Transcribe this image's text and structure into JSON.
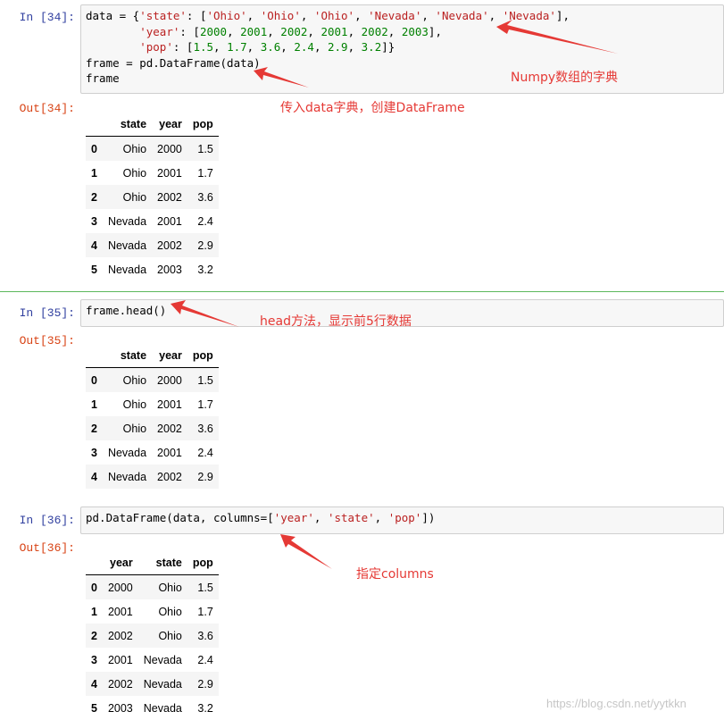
{
  "cells": [
    {
      "in_prompt": "In  [34]:",
      "out_prompt": "Out[34]:",
      "code_lines": [
        [
          [
            "k",
            "data = {"
          ],
          [
            "s",
            "'state'"
          ],
          [
            "k",
            ": ["
          ],
          [
            "s",
            "'Ohio'"
          ],
          [
            "k",
            ", "
          ],
          [
            "s",
            "'Ohio'"
          ],
          [
            "k",
            ", "
          ],
          [
            "s",
            "'Ohio'"
          ],
          [
            "k",
            ", "
          ],
          [
            "s",
            "'Nevada'"
          ],
          [
            "k",
            ", "
          ],
          [
            "s",
            "'Nevada'"
          ],
          [
            "k",
            ", "
          ],
          [
            "s",
            "'Nevada'"
          ],
          [
            "k",
            "],"
          ]
        ],
        [
          [
            "k",
            "        "
          ],
          [
            "s",
            "'year'"
          ],
          [
            "k",
            ": ["
          ],
          [
            "n",
            "2000"
          ],
          [
            "k",
            ", "
          ],
          [
            "n",
            "2001"
          ],
          [
            "k",
            ", "
          ],
          [
            "n",
            "2002"
          ],
          [
            "k",
            ", "
          ],
          [
            "n",
            "2001"
          ],
          [
            "k",
            ", "
          ],
          [
            "n",
            "2002"
          ],
          [
            "k",
            ", "
          ],
          [
            "n",
            "2003"
          ],
          [
            "k",
            "],"
          ]
        ],
        [
          [
            "k",
            "        "
          ],
          [
            "s",
            "'pop'"
          ],
          [
            "k",
            ": ["
          ],
          [
            "n",
            "1.5"
          ],
          [
            "k",
            ", "
          ],
          [
            "n",
            "1.7"
          ],
          [
            "k",
            ", "
          ],
          [
            "n",
            "3.6"
          ],
          [
            "k",
            ", "
          ],
          [
            "n",
            "2.4"
          ],
          [
            "k",
            ", "
          ],
          [
            "n",
            "2.9"
          ],
          [
            "k",
            ", "
          ],
          [
            "n",
            "3.2"
          ],
          [
            "k",
            "]}"
          ]
        ],
        [
          [
            "k",
            "frame = pd.DataFrame(data)"
          ]
        ],
        [
          [
            "k",
            "frame"
          ]
        ]
      ],
      "table": {
        "columns": [
          "state",
          "year",
          "pop"
        ],
        "rows": [
          [
            "0",
            "Ohio",
            "2000",
            "1.5"
          ],
          [
            "1",
            "Ohio",
            "2001",
            "1.7"
          ],
          [
            "2",
            "Ohio",
            "2002",
            "3.6"
          ],
          [
            "3",
            "Nevada",
            "2001",
            "2.4"
          ],
          [
            "4",
            "Nevada",
            "2002",
            "2.9"
          ],
          [
            "5",
            "Nevada",
            "2003",
            "3.2"
          ]
        ]
      }
    },
    {
      "in_prompt": "In  [35]:",
      "out_prompt": "Out[35]:",
      "code_lines": [
        [
          [
            "k",
            "frame.head()"
          ]
        ]
      ],
      "table": {
        "columns": [
          "state",
          "year",
          "pop"
        ],
        "rows": [
          [
            "0",
            "Ohio",
            "2000",
            "1.5"
          ],
          [
            "1",
            "Ohio",
            "2001",
            "1.7"
          ],
          [
            "2",
            "Ohio",
            "2002",
            "3.6"
          ],
          [
            "3",
            "Nevada",
            "2001",
            "2.4"
          ],
          [
            "4",
            "Nevada",
            "2002",
            "2.9"
          ]
        ]
      }
    },
    {
      "in_prompt": "In  [36]:",
      "out_prompt": "Out[36]:",
      "code_lines": [
        [
          [
            "k",
            "pd.DataFrame(data, columns=["
          ],
          [
            "s",
            "'year'"
          ],
          [
            "k",
            ", "
          ],
          [
            "s",
            "'state'"
          ],
          [
            "k",
            ", "
          ],
          [
            "s",
            "'pop'"
          ],
          [
            "k",
            "])"
          ]
        ]
      ],
      "table": {
        "columns": [
          "year",
          "state",
          "pop"
        ],
        "rows": [
          [
            "0",
            "2000",
            "Ohio",
            "1.5"
          ],
          [
            "1",
            "2001",
            "Ohio",
            "1.7"
          ],
          [
            "2",
            "2002",
            "Ohio",
            "3.6"
          ],
          [
            "3",
            "2001",
            "Nevada",
            "2.4"
          ],
          [
            "4",
            "2002",
            "Nevada",
            "2.9"
          ],
          [
            "5",
            "2003",
            "Nevada",
            "3.2"
          ]
        ]
      }
    }
  ],
  "annotations": {
    "numpy_dict": "Numpy数组的字典",
    "pass_dict": "传入data字典，创建DataFrame",
    "head_method": "head方法，显示前5行数据",
    "columns": "指定columns"
  },
  "watermark": "https://blog.csdn.net/yytkkn",
  "colors": {
    "annotation": "#e53935",
    "in_prompt": "#303f9f",
    "out_prompt": "#d84315",
    "separator": "#5cb85c",
    "string": "#ba2121",
    "number": "#008000"
  }
}
